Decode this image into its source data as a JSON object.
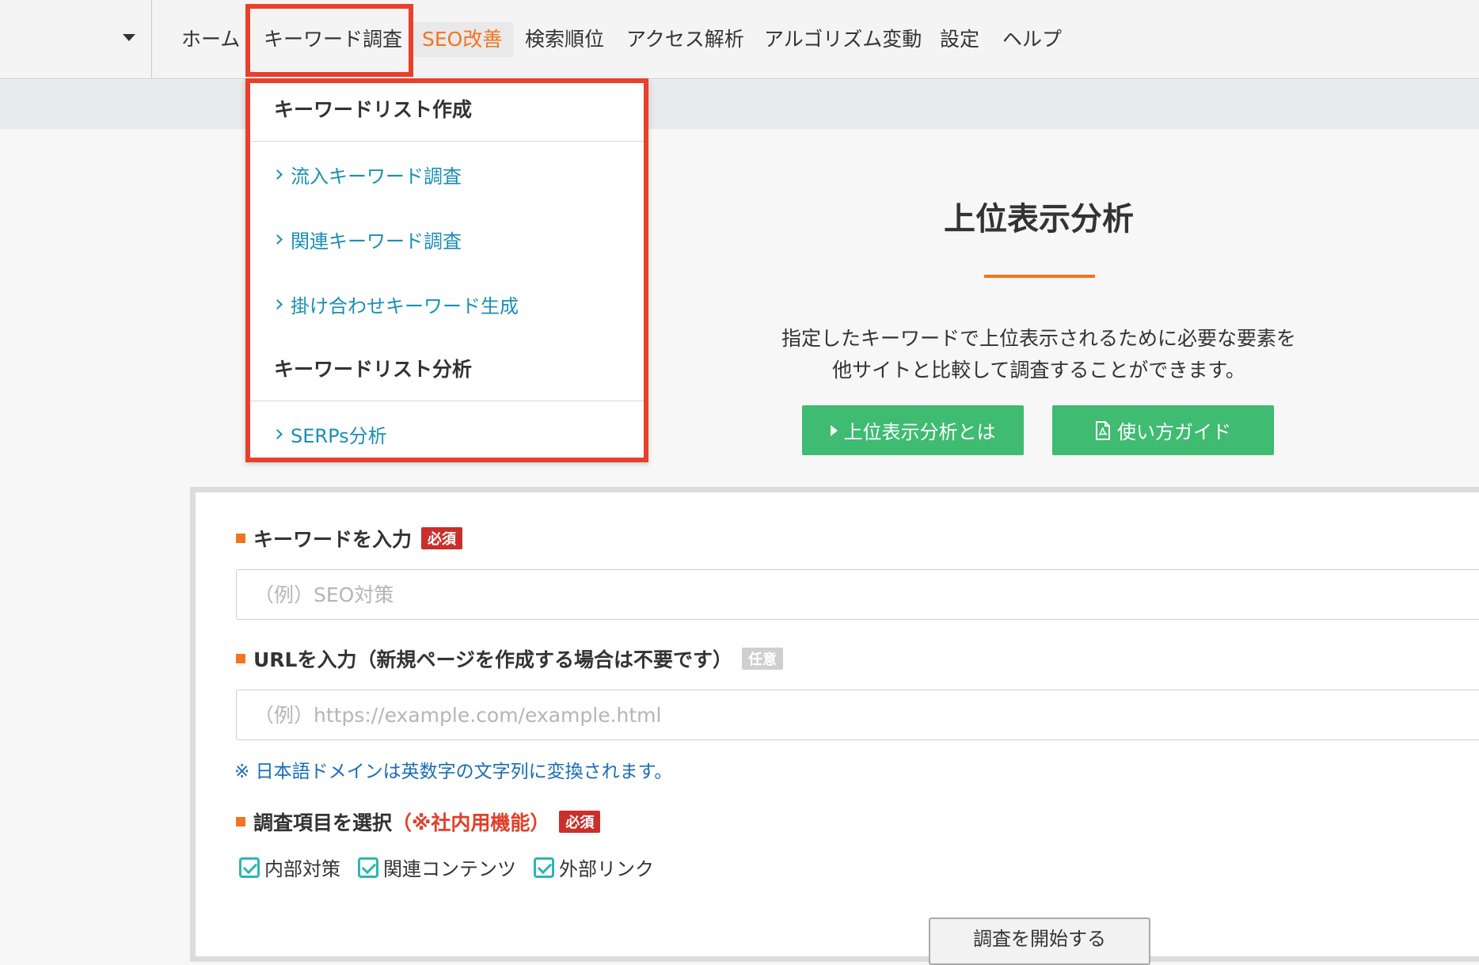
{
  "nav": {
    "items": [
      {
        "label": "ホーム"
      },
      {
        "label": "キーワード調査"
      },
      {
        "label": "SEO改善"
      },
      {
        "label": "検索順位"
      },
      {
        "label": "アクセス解析"
      },
      {
        "label": "アルゴリズム変動"
      },
      {
        "label": "設定"
      },
      {
        "label": "ヘルプ"
      }
    ]
  },
  "dropdown": {
    "section1_heading": "キーワードリスト作成",
    "links1": [
      "流入キーワード調査",
      "関連キーワード調査",
      "掛け合わせキーワード生成"
    ],
    "section2_heading": "キーワードリスト分析",
    "links2": [
      "SERPs分析"
    ]
  },
  "hero": {
    "title": "上位表示分析",
    "desc_line1": "指定したキーワードで上位表示されるために必要な要素を",
    "desc_line2": "他サイトと比較して調査することができます。",
    "about_btn": "上位表示分析とは",
    "guide_btn": "使い方ガイド"
  },
  "form": {
    "keyword_label": "キーワードを入力",
    "required_badge": "必須",
    "optional_badge": "任意",
    "keyword_placeholder": "（例）SEO対策",
    "url_label": "URLを入力（新規ページを作成する場合は不要です）",
    "url_placeholder": "（例）https://example.com/example.html",
    "url_note": "※ 日本語ドメインは英数字の文字列に変換されます。",
    "items_label": "調査項目を選択",
    "items_note": "（※社内用機能）",
    "checkboxes": [
      "内部対策",
      "関連コンテンツ",
      "外部リンク"
    ],
    "start_btn": "調査を開始する"
  },
  "colors": {
    "accent_orange": "#f07422",
    "highlight_red": "#e8402b",
    "green": "#3fbb72",
    "link_teal": "#1a8fb5",
    "checkbox_teal": "#2fb5b5"
  }
}
